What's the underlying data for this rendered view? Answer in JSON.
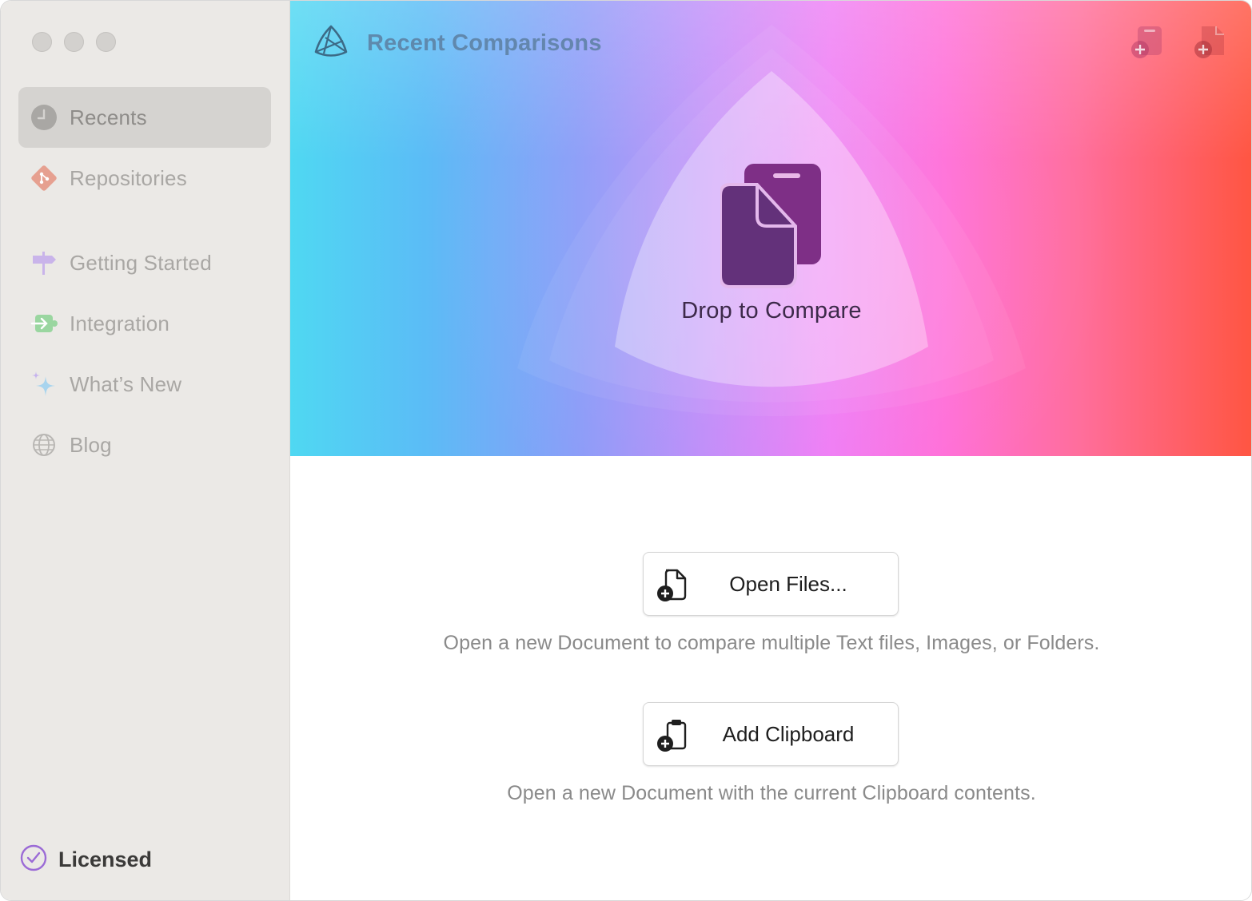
{
  "sidebar": {
    "items": [
      {
        "label": "Recents",
        "icon": "clock-icon",
        "active": true
      },
      {
        "label": "Repositories",
        "icon": "git-icon"
      },
      {
        "label": "Getting Started",
        "icon": "signpost-icon"
      },
      {
        "label": "Integration",
        "icon": "plug-arrow-icon"
      },
      {
        "label": "What’s New",
        "icon": "sparkle-icon"
      },
      {
        "label": "Blog",
        "icon": "globe-icon"
      }
    ],
    "licensed": "Licensed"
  },
  "header": {
    "title": "Recent Comparisons",
    "new_document_button": "new-document-icon",
    "new_file_button": "new-file-icon"
  },
  "hero": {
    "drop_label": "Drop to Compare"
  },
  "actions": {
    "open_files": {
      "label": "Open Files...",
      "description": "Open a new Document to compare multiple Text files, Images, or Folders."
    },
    "add_clipboard": {
      "label": "Add Clipboard",
      "description": "Open a new Document with the current Clipboard contents."
    }
  },
  "colors": {
    "sidebar_bg": "#ebe9e6",
    "accent_purple": "#9b6bd6",
    "hero_gradient_start": "#4fd8f2",
    "hero_gradient_end": "#ff5541"
  }
}
